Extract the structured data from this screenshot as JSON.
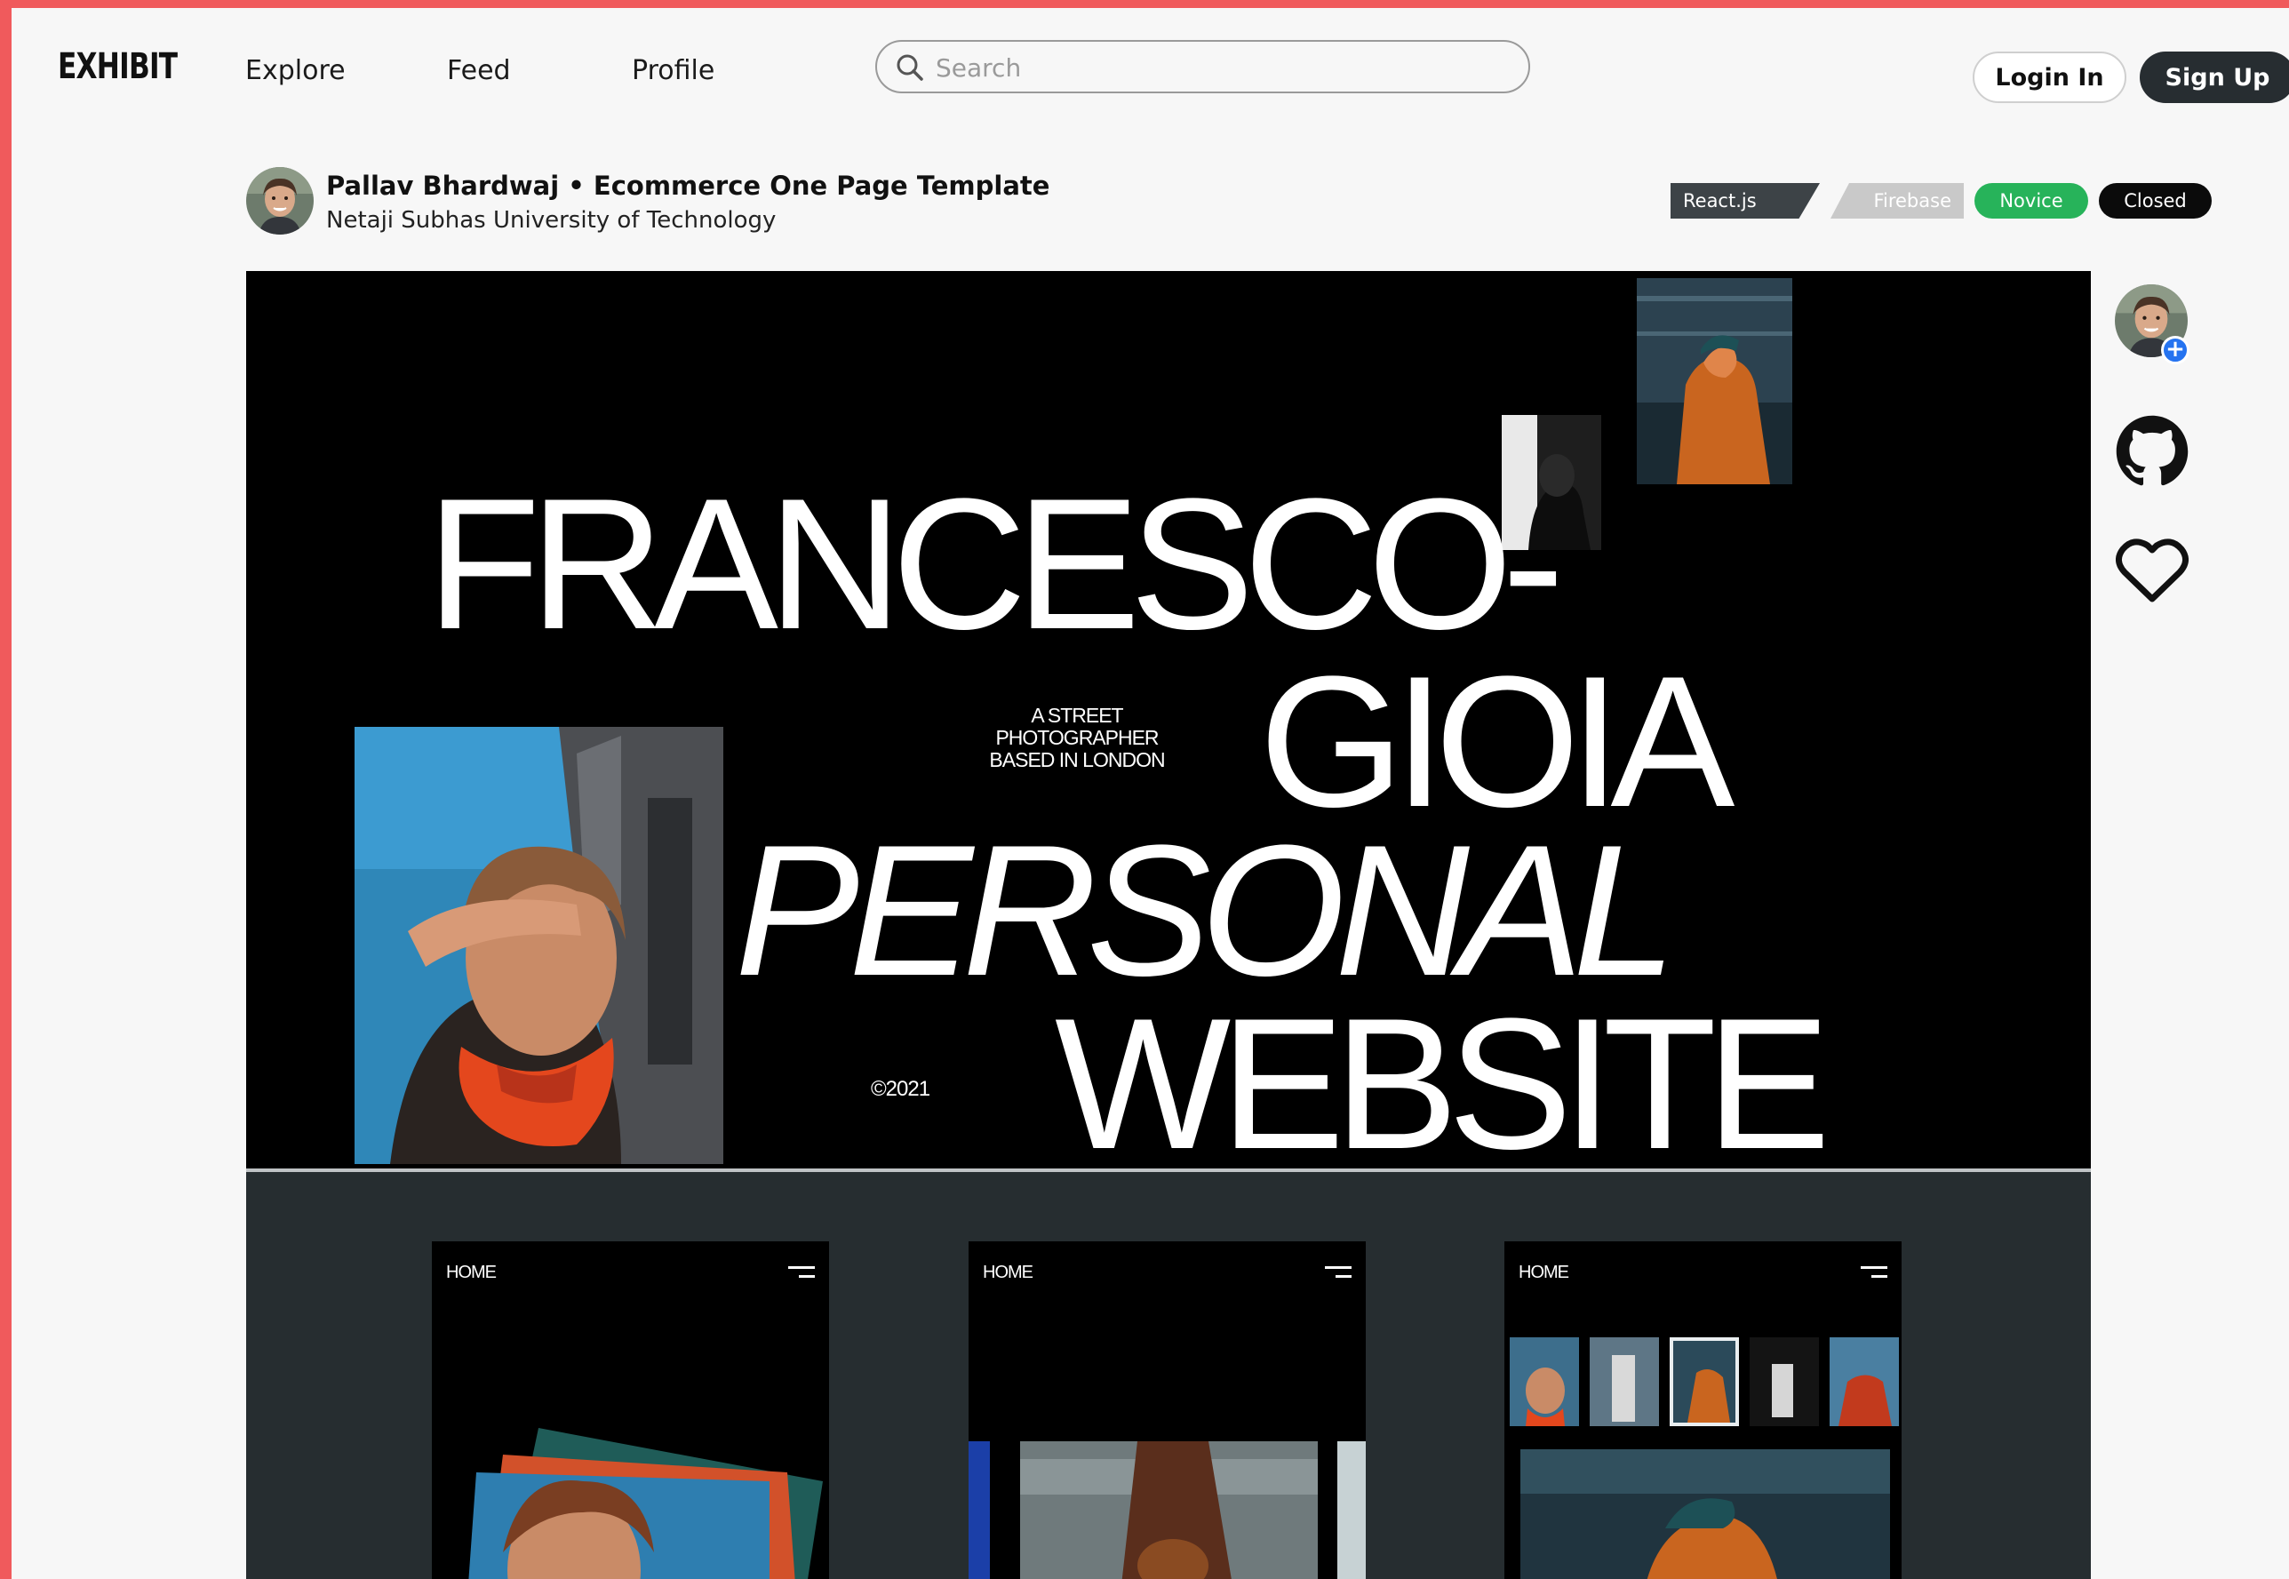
{
  "nav": {
    "logo": "EXHIBIT",
    "links": [
      "Explore",
      "Feed",
      "Profile"
    ],
    "search_placeholder": "Search",
    "login_label": "Login In",
    "signup_label": "Sign Up"
  },
  "project": {
    "title": "Pallav Bhardwaj • Ecommerce One Page Template",
    "subtitle": "Netaji Subhas University of Technology",
    "tags": [
      "React.js",
      "Firebase",
      "Novice",
      "Closed"
    ]
  },
  "hero": {
    "line1": "FRANCESCO-",
    "line2": "GIOIA",
    "line3": "PERSONAL",
    "line4": "WEBSITE",
    "tagline": "A STREET\nPHOTOGRAPHER\nBASED IN LONDON",
    "copyright": "©2021"
  },
  "screens": [
    {
      "label": "HOME"
    },
    {
      "label": "HOME"
    },
    {
      "label": "HOME"
    }
  ],
  "side_actions": {
    "icons": [
      "follow-avatar-icon",
      "plus-icon",
      "github-icon",
      "heart-icon"
    ]
  },
  "colors": {
    "frame": "#f05a5c",
    "novice": "#27b35a",
    "closed": "#0b0b0b",
    "react": "#3d4347",
    "firebase": "#c9c9c9",
    "follow_plus": "#2573f0",
    "signup": "#272d31"
  }
}
